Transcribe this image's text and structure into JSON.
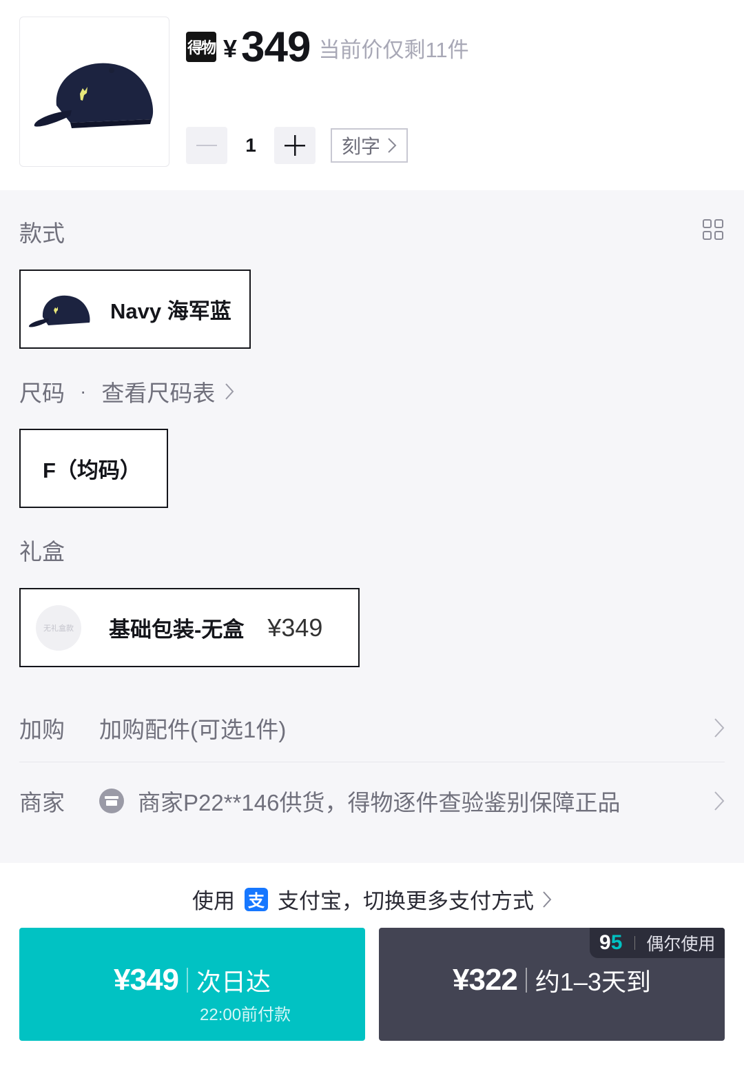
{
  "product": {
    "brand_logo": "得物",
    "currency": "¥",
    "price": "349",
    "stock_note": "当前价仅剩11件",
    "quantity": "1",
    "engrave_label": "刻字",
    "image_icon": "navy-cap-icon"
  },
  "options": {
    "style_label": "款式",
    "style_choice": "Navy 海军蓝",
    "size_label": "尺码",
    "size_chart_link": "查看尺码表",
    "size_choice": "F（均码）",
    "gift_label": "礼盒",
    "gift_thumb_text": "无礼盒款",
    "gift_choice": "基础包装-无盒",
    "gift_price": "¥349",
    "addon_label": "加购",
    "addon_value": "加购配件(可选1件)",
    "seller_label": "商家",
    "seller_value": "商家P22**146供货，得物逐件查验鉴别保障正品"
  },
  "payment": {
    "prefix": "使用",
    "method": "支付宝，切换更多支付方式",
    "alipay_glyph": "支"
  },
  "buttons": {
    "left_price": "¥349",
    "left_desc": "次日达",
    "left_sub": "22:00前付款",
    "right_price": "¥322",
    "right_desc": "约1–3天到",
    "badge_num_a": "9",
    "badge_num_b": "5",
    "badge_text": "偶尔使用"
  },
  "colors": {
    "accent": "#01c2c3",
    "dark_button": "#434453",
    "background": "#f6f6f9"
  }
}
